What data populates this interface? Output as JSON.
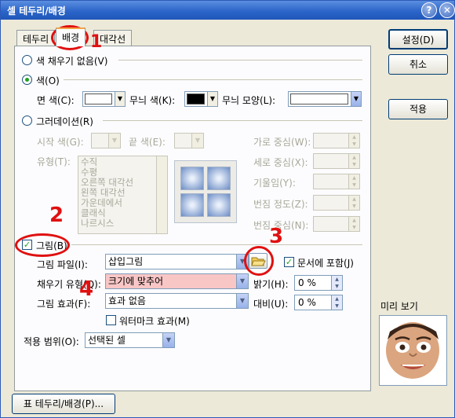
{
  "window": {
    "title": "셀 테두리/배경",
    "help_glyph": "?",
    "close_glyph": "✕"
  },
  "tabs": [
    {
      "label": "테두리",
      "active": false
    },
    {
      "label": "배경",
      "active": true
    },
    {
      "label": "대각선",
      "active": false
    }
  ],
  "fill": {
    "no_color_label": "색 채우기 없음(V)",
    "color_label": "색(O)",
    "face_color_label": "면 색(C):",
    "face_color_value": "#ffffff",
    "pattern_color_label": "무늬 색(K):",
    "pattern_color_value": "#000000",
    "pattern_shape_label": "무늬 모양(L):",
    "gradation_label": "그러데이션(R)",
    "start_color_label": "시작 색(G):",
    "end_color_label": "끝 색(E):",
    "type_label": "유형(T):",
    "type_list": [
      "수직",
      "수평",
      "오른쪽 대각선",
      "왼쪽 대각선",
      "가운데에서",
      "클래식",
      "나르시스"
    ],
    "h_center_label": "가로 중심(W):",
    "v_center_label": "세로 중심(X):",
    "tilt_label": "기울임(Y):",
    "blur_label": "번짐 정도(Z):",
    "blur_center_label": "번짐 중심(N):"
  },
  "picture": {
    "checkbox_label": "그림(B)",
    "checked": true,
    "file_label": "그림 파일(I):",
    "file_value": "삽입그림",
    "include_in_doc_label": "문서에 포함(J)",
    "include_in_doc_checked": true,
    "fill_method_label": "채우기 유형(Q):",
    "fill_method_value": "크기에 맞추어",
    "brightness_label": "밝기(H):",
    "brightness_value": "0 %",
    "effect_label": "그림 효과(F):",
    "effect_value": "효과 없음",
    "contrast_label": "대비(U):",
    "contrast_value": "0 %",
    "watermark_label": "워터마크 효과(M)",
    "watermark_checked": false
  },
  "apply_scope": {
    "label": "적용 범위(O):",
    "value": "선택된 셀"
  },
  "buttons": {
    "ok": "설정(D)",
    "cancel": "취소",
    "apply": "적용",
    "table_border": "표 테두리/배경(P)..."
  },
  "preview": {
    "label": "미리 보기"
  },
  "annotations": {
    "step1": "1",
    "step2": "2",
    "step3": "3",
    "step4": "4",
    "color": "#e01010"
  }
}
